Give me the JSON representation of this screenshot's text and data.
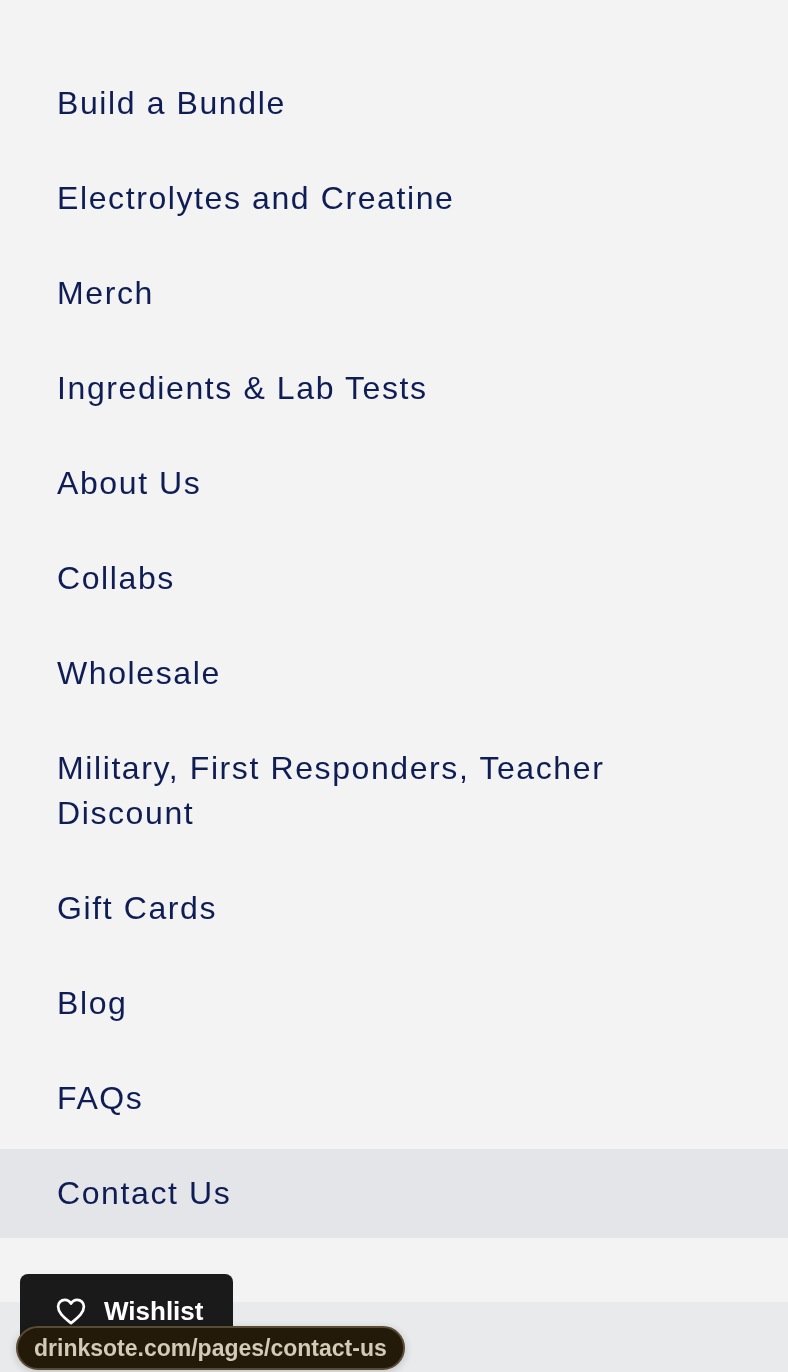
{
  "menu": {
    "items": [
      {
        "label": "Build a Bundle",
        "selected": false
      },
      {
        "label": "Electrolytes and Creatine",
        "selected": false
      },
      {
        "label": "Merch",
        "selected": false
      },
      {
        "label": "Ingredients & Lab Tests",
        "selected": false
      },
      {
        "label": "About Us",
        "selected": false
      },
      {
        "label": "Collabs",
        "selected": false
      },
      {
        "label": "Wholesale",
        "selected": false
      },
      {
        "label": "Military, First Responders, Teacher Discount",
        "selected": false
      },
      {
        "label": "Gift Cards",
        "selected": false
      },
      {
        "label": "Blog",
        "selected": false
      },
      {
        "label": "FAQs",
        "selected": false
      },
      {
        "label": "Contact Us",
        "selected": true
      }
    ]
  },
  "wishlist_button": {
    "label": "Wishlist"
  },
  "link_preview": {
    "url": "drinksote.com/pages/contact-us"
  }
}
